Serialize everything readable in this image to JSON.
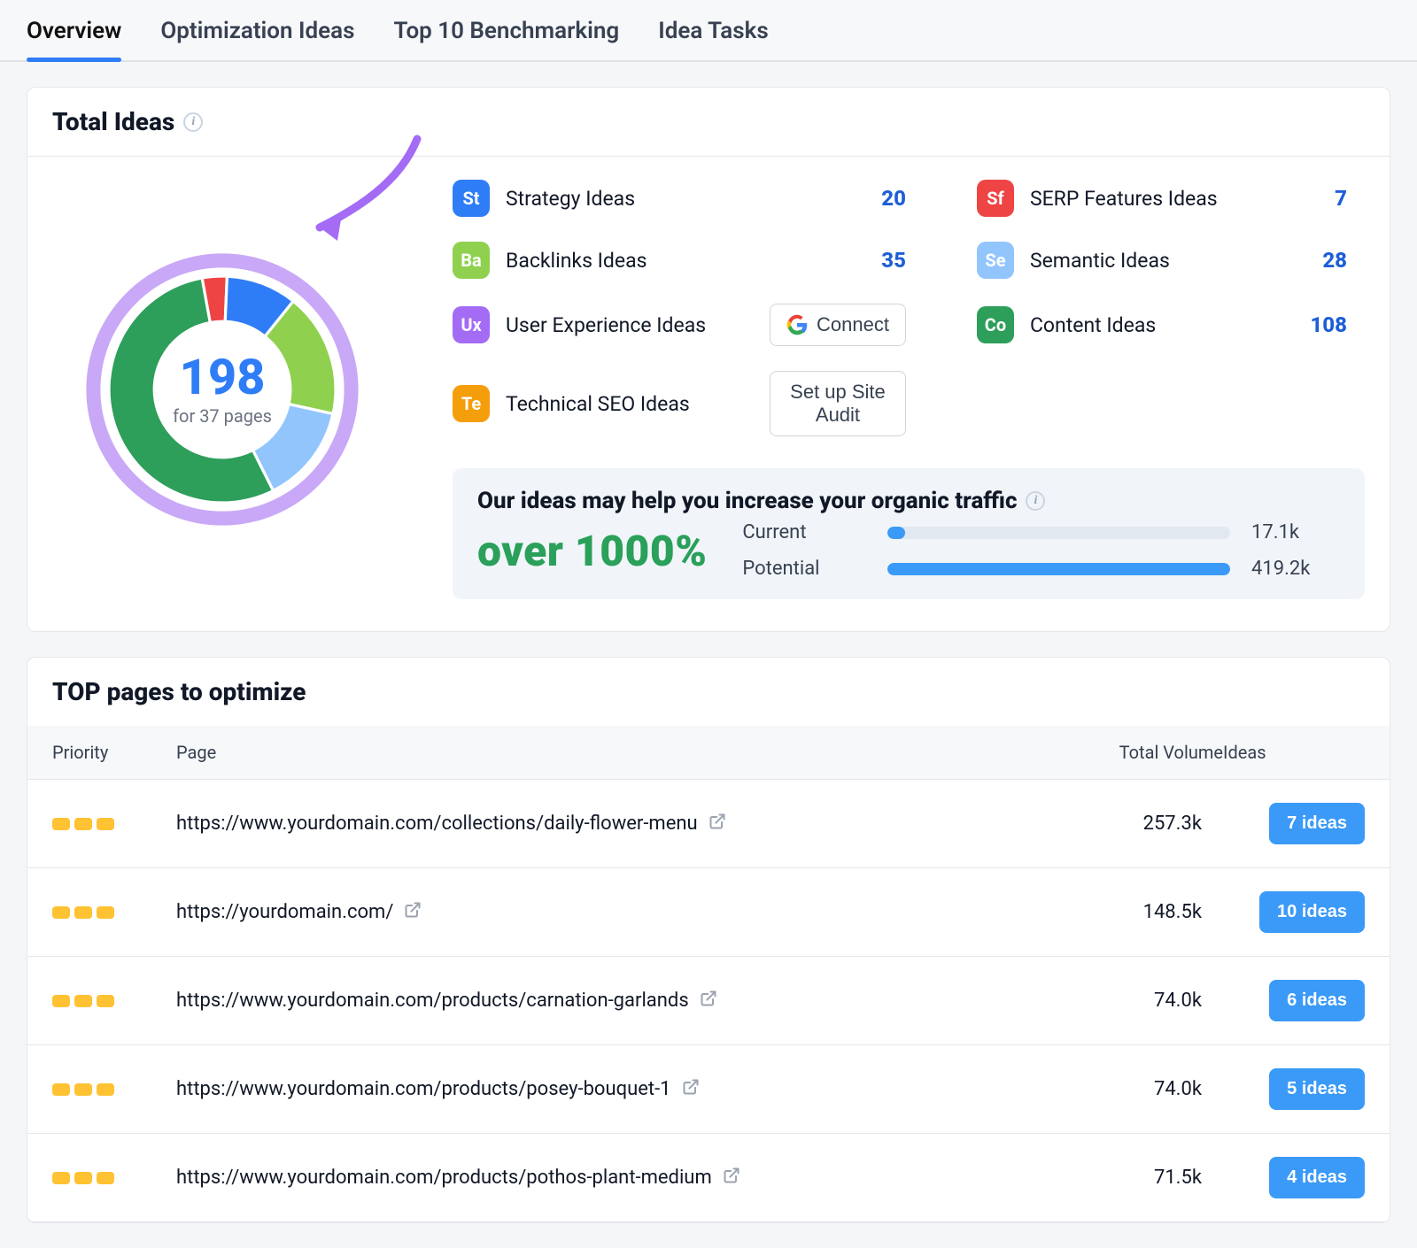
{
  "tabs": [
    "Overview",
    "Optimization Ideas",
    "Top 10 Benchmarking",
    "Idea Tasks"
  ],
  "active_tab": 0,
  "total_ideas": {
    "title": "Total Ideas",
    "count": "198",
    "pages_line": "for 37 pages",
    "categories_left": [
      {
        "code": "St",
        "color": "#2f7df6",
        "label": "Strategy Ideas",
        "value": "20"
      },
      {
        "code": "Ba",
        "color": "#8fd14f",
        "label": "Backlinks Ideas",
        "value": "35"
      },
      {
        "code": "Ux",
        "color": "#a46bf5",
        "label": "User Experience Ideas",
        "button": "Connect",
        "google": true
      },
      {
        "code": "Te",
        "color": "#f59e0b",
        "label": "Technical SEO Ideas",
        "button": "Set up Site Audit"
      }
    ],
    "categories_right": [
      {
        "code": "Sf",
        "color": "#ef4444",
        "label": "SERP Features Ideas",
        "value": "7"
      },
      {
        "code": "Se",
        "color": "#93c5fd",
        "label": "Semantic Ideas",
        "value": "28"
      },
      {
        "code": "Co",
        "color": "#2e9e5b",
        "label": "Content Ideas",
        "value": "108"
      }
    ],
    "growth": {
      "headline": "Our ideas may help you increase your organic traffic",
      "percent": "over 1000%",
      "rows": [
        {
          "label": "Current",
          "value": "17.1k",
          "pct": 5
        },
        {
          "label": "Potential",
          "value": "419.2k",
          "pct": 100
        }
      ]
    }
  },
  "chart_data": {
    "type": "pie",
    "title": "Total Ideas",
    "series": [
      {
        "name": "Content Ideas",
        "value": 108,
        "color": "#2e9e5b"
      },
      {
        "name": "Backlinks Ideas",
        "value": 35,
        "color": "#8fd14f"
      },
      {
        "name": "Semantic Ideas",
        "value": 28,
        "color": "#93c5fd"
      },
      {
        "name": "Strategy Ideas",
        "value": 20,
        "color": "#2f7df6"
      },
      {
        "name": "SERP Features Ideas",
        "value": 7,
        "color": "#ef4444"
      }
    ],
    "total": 198,
    "subtitle": "for 37 pages"
  },
  "top_pages": {
    "title": "TOP pages to optimize",
    "columns": [
      "Priority",
      "Page",
      "Total Volume",
      "Ideas"
    ],
    "rows": [
      {
        "url": "https://www.yourdomain.com/collections/daily-flower-menu",
        "volume": "257.3k",
        "ideas": "7 ideas"
      },
      {
        "url": "https://yourdomain.com/",
        "volume": "148.5k",
        "ideas": "10 ideas"
      },
      {
        "url": "https://www.yourdomain.com/products/carnation-garlands",
        "volume": "74.0k",
        "ideas": "6 ideas"
      },
      {
        "url": "https://www.yourdomain.com/products/posey-bouquet-1",
        "volume": "74.0k",
        "ideas": "5 ideas"
      },
      {
        "url": "https://www.yourdomain.com/products/pothos-plant-medium",
        "volume": "71.5k",
        "ideas": "4 ideas"
      }
    ]
  }
}
